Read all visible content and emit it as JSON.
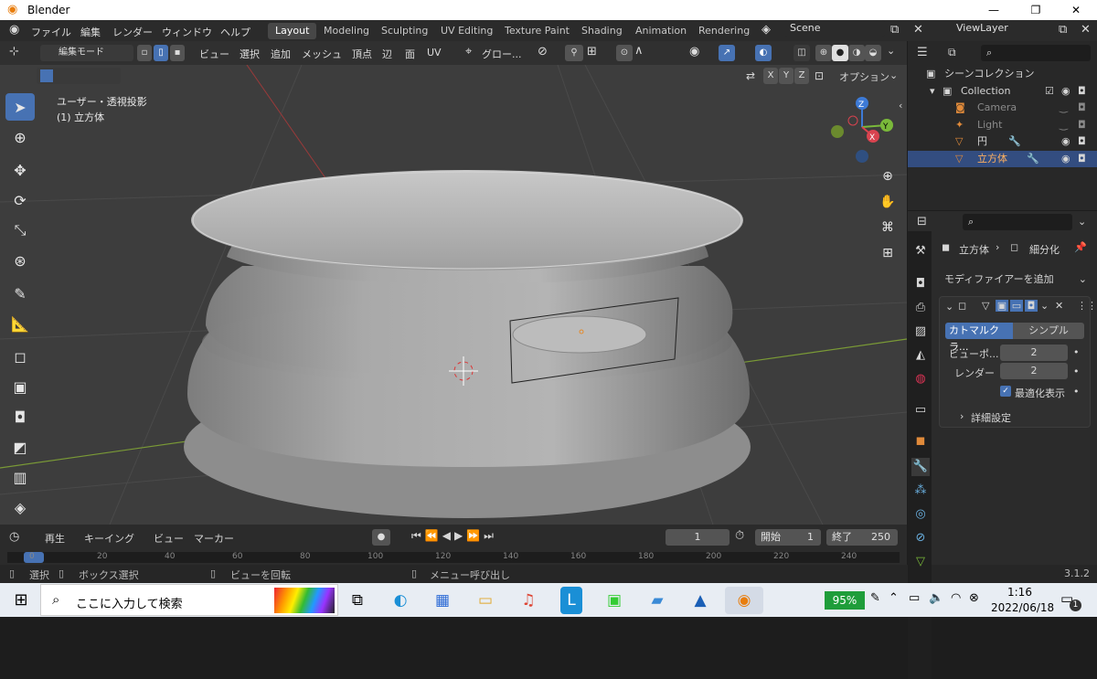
{
  "titlebar": {
    "title": "Blender",
    "min": "—",
    "max": "❐",
    "close": "✕"
  },
  "topmenu": {
    "items": [
      "ファイル",
      "編集",
      "レンダー",
      "ウィンドウ",
      "ヘルプ"
    ],
    "workspaces": [
      "Layout",
      "Modeling",
      "Sculpting",
      "UV Editing",
      "Texture Paint",
      "Shading",
      "Animation",
      "Rendering"
    ],
    "scene": "Scene",
    "viewlayer": "ViewLayer"
  },
  "viewport_header": {
    "mode": "編集モード",
    "menus": [
      "ビュー",
      "選択",
      "追加",
      "メッシュ",
      "頂点",
      "辺",
      "面",
      "UV"
    ],
    "transform": "グロー...",
    "options": "オプション",
    "axes": [
      "X",
      "Y",
      "Z"
    ]
  },
  "overlay": {
    "view_name": "ユーザー・透視投影",
    "object_name": "(1) 立方体"
  },
  "gizmo": {
    "z": "Z",
    "y": "Y",
    "x": "X"
  },
  "timeline": {
    "playback": "再生",
    "keying": "キーイング",
    "view": "ビュー",
    "marker": "マーカー",
    "current_frame": "1",
    "start_label": "開始",
    "start": "1",
    "end_label": "終了",
    "end": "250",
    "ruler": [
      "0",
      "20",
      "40",
      "60",
      "80",
      "100",
      "120",
      "140",
      "160",
      "180",
      "200",
      "220",
      "240"
    ]
  },
  "statusbar": {
    "select": "選択",
    "box_select": "ボックス選択",
    "rotate_view": "ビューを回転",
    "call_menu": "メニュー呼び出し",
    "version": "3.1.2"
  },
  "outliner": {
    "scene_collection": "シーンコレクション",
    "collection": "Collection",
    "items": [
      "Camera",
      "Light",
      "円",
      "立方体"
    ]
  },
  "properties": {
    "object": "立方体",
    "modifier": "細分化",
    "add_modifier": "モディファイアーを追加",
    "tab_catmull": "カトマルクラ...",
    "tab_simple": "シンプル",
    "viewport_label": "ビューポ...",
    "viewport_value": "2",
    "render_label": "レンダー",
    "render_value": "2",
    "optimal": "最適化表示",
    "advanced": "詳細設定"
  },
  "taskbar": {
    "search": "ここに入力して検索",
    "battery": "95%",
    "time": "1:16",
    "date": "2022/06/18",
    "notif": "1"
  }
}
